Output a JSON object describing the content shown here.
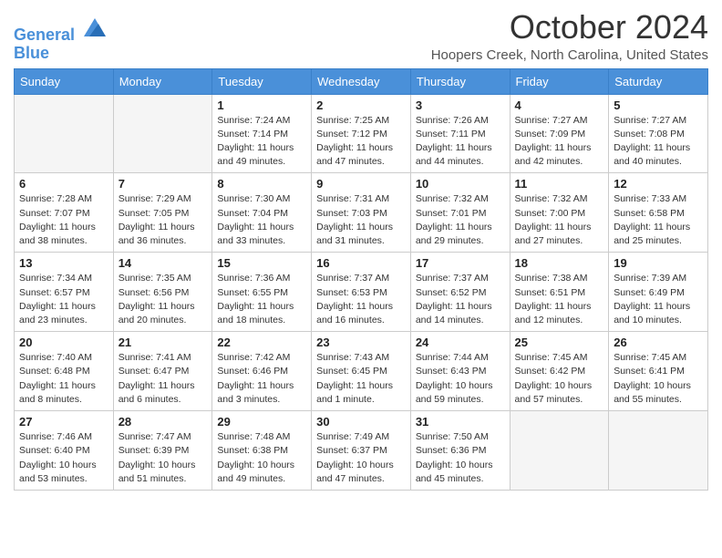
{
  "header": {
    "logo_line1": "General",
    "logo_line2": "Blue",
    "title": "October 2024",
    "location": "Hoopers Creek, North Carolina, United States"
  },
  "days_of_week": [
    "Sunday",
    "Monday",
    "Tuesday",
    "Wednesday",
    "Thursday",
    "Friday",
    "Saturday"
  ],
  "weeks": [
    [
      {
        "day": "",
        "info": ""
      },
      {
        "day": "",
        "info": ""
      },
      {
        "day": "1",
        "info": "Sunrise: 7:24 AM\nSunset: 7:14 PM\nDaylight: 11 hours and 49 minutes."
      },
      {
        "day": "2",
        "info": "Sunrise: 7:25 AM\nSunset: 7:12 PM\nDaylight: 11 hours and 47 minutes."
      },
      {
        "day": "3",
        "info": "Sunrise: 7:26 AM\nSunset: 7:11 PM\nDaylight: 11 hours and 44 minutes."
      },
      {
        "day": "4",
        "info": "Sunrise: 7:27 AM\nSunset: 7:09 PM\nDaylight: 11 hours and 42 minutes."
      },
      {
        "day": "5",
        "info": "Sunrise: 7:27 AM\nSunset: 7:08 PM\nDaylight: 11 hours and 40 minutes."
      }
    ],
    [
      {
        "day": "6",
        "info": "Sunrise: 7:28 AM\nSunset: 7:07 PM\nDaylight: 11 hours and 38 minutes."
      },
      {
        "day": "7",
        "info": "Sunrise: 7:29 AM\nSunset: 7:05 PM\nDaylight: 11 hours and 36 minutes."
      },
      {
        "day": "8",
        "info": "Sunrise: 7:30 AM\nSunset: 7:04 PM\nDaylight: 11 hours and 33 minutes."
      },
      {
        "day": "9",
        "info": "Sunrise: 7:31 AM\nSunset: 7:03 PM\nDaylight: 11 hours and 31 minutes."
      },
      {
        "day": "10",
        "info": "Sunrise: 7:32 AM\nSunset: 7:01 PM\nDaylight: 11 hours and 29 minutes."
      },
      {
        "day": "11",
        "info": "Sunrise: 7:32 AM\nSunset: 7:00 PM\nDaylight: 11 hours and 27 minutes."
      },
      {
        "day": "12",
        "info": "Sunrise: 7:33 AM\nSunset: 6:58 PM\nDaylight: 11 hours and 25 minutes."
      }
    ],
    [
      {
        "day": "13",
        "info": "Sunrise: 7:34 AM\nSunset: 6:57 PM\nDaylight: 11 hours and 23 minutes."
      },
      {
        "day": "14",
        "info": "Sunrise: 7:35 AM\nSunset: 6:56 PM\nDaylight: 11 hours and 20 minutes."
      },
      {
        "day": "15",
        "info": "Sunrise: 7:36 AM\nSunset: 6:55 PM\nDaylight: 11 hours and 18 minutes."
      },
      {
        "day": "16",
        "info": "Sunrise: 7:37 AM\nSunset: 6:53 PM\nDaylight: 11 hours and 16 minutes."
      },
      {
        "day": "17",
        "info": "Sunrise: 7:37 AM\nSunset: 6:52 PM\nDaylight: 11 hours and 14 minutes."
      },
      {
        "day": "18",
        "info": "Sunrise: 7:38 AM\nSunset: 6:51 PM\nDaylight: 11 hours and 12 minutes."
      },
      {
        "day": "19",
        "info": "Sunrise: 7:39 AM\nSunset: 6:49 PM\nDaylight: 11 hours and 10 minutes."
      }
    ],
    [
      {
        "day": "20",
        "info": "Sunrise: 7:40 AM\nSunset: 6:48 PM\nDaylight: 11 hours and 8 minutes."
      },
      {
        "day": "21",
        "info": "Sunrise: 7:41 AM\nSunset: 6:47 PM\nDaylight: 11 hours and 6 minutes."
      },
      {
        "day": "22",
        "info": "Sunrise: 7:42 AM\nSunset: 6:46 PM\nDaylight: 11 hours and 3 minutes."
      },
      {
        "day": "23",
        "info": "Sunrise: 7:43 AM\nSunset: 6:45 PM\nDaylight: 11 hours and 1 minute."
      },
      {
        "day": "24",
        "info": "Sunrise: 7:44 AM\nSunset: 6:43 PM\nDaylight: 10 hours and 59 minutes."
      },
      {
        "day": "25",
        "info": "Sunrise: 7:45 AM\nSunset: 6:42 PM\nDaylight: 10 hours and 57 minutes."
      },
      {
        "day": "26",
        "info": "Sunrise: 7:45 AM\nSunset: 6:41 PM\nDaylight: 10 hours and 55 minutes."
      }
    ],
    [
      {
        "day": "27",
        "info": "Sunrise: 7:46 AM\nSunset: 6:40 PM\nDaylight: 10 hours and 53 minutes."
      },
      {
        "day": "28",
        "info": "Sunrise: 7:47 AM\nSunset: 6:39 PM\nDaylight: 10 hours and 51 minutes."
      },
      {
        "day": "29",
        "info": "Sunrise: 7:48 AM\nSunset: 6:38 PM\nDaylight: 10 hours and 49 minutes."
      },
      {
        "day": "30",
        "info": "Sunrise: 7:49 AM\nSunset: 6:37 PM\nDaylight: 10 hours and 47 minutes."
      },
      {
        "day": "31",
        "info": "Sunrise: 7:50 AM\nSunset: 6:36 PM\nDaylight: 10 hours and 45 minutes."
      },
      {
        "day": "",
        "info": ""
      },
      {
        "day": "",
        "info": ""
      }
    ]
  ]
}
